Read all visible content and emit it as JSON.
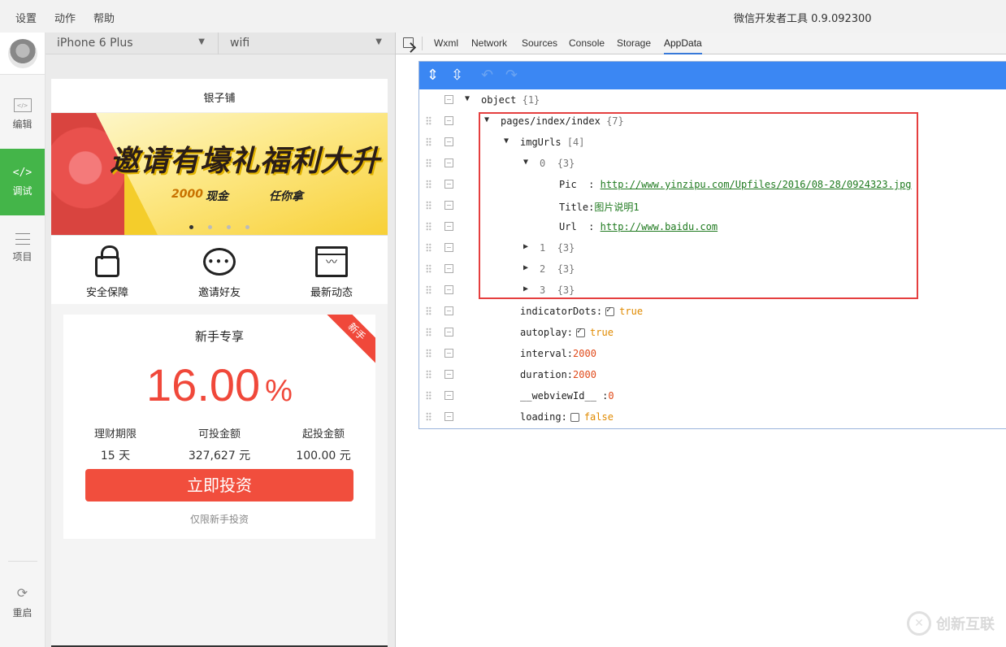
{
  "menu": {
    "items": [
      "设置",
      "动作",
      "帮助"
    ],
    "app_title": "微信开发者工具 0.9.092300"
  },
  "sidebar": {
    "items": [
      {
        "label": "编辑",
        "icon": "code-file-icon"
      },
      {
        "label": "调试",
        "icon": "code-brackets-icon",
        "glyph": "</>"
      },
      {
        "label": "项目",
        "icon": "list-icon"
      },
      {
        "label": "重启",
        "icon": "restart-icon"
      }
    ],
    "active": "调试"
  },
  "simulator": {
    "device": "iPhone 6 Plus",
    "network": "wifi"
  },
  "phone": {
    "nav_title": "银子铺",
    "banner": {
      "headline": "邀请有壕礼福利大升",
      "sub_cash": "2000",
      "sub_cash_unit": "现金",
      "sub_pick": "任你拿"
    },
    "features": [
      {
        "label": "安全保障",
        "icon": "lock-icon"
      },
      {
        "label": "邀请好友",
        "icon": "chat-bubble-icon"
      },
      {
        "label": "最新动态",
        "icon": "activity-monitor-icon"
      }
    ],
    "card": {
      "ribbon": "新手",
      "title": "新手专享",
      "rate_value": "16.00",
      "rate_unit": "%",
      "stats": [
        {
          "label": "理财期限",
          "value": "15 天"
        },
        {
          "label": "可投金额",
          "value": "327,627 元"
        },
        {
          "label": "起投金额",
          "value": "100.00 元"
        }
      ],
      "button": "立即投资",
      "note": "仅限新手投资"
    }
  },
  "devtools": {
    "tabs": [
      "Wxml",
      "Network",
      "Sources",
      "Console",
      "Storage",
      "AppData"
    ],
    "active_tab": "AppData",
    "tree": {
      "root": {
        "key": "object",
        "count": "{1}"
      },
      "page": {
        "key": "pages/index/index",
        "count": "{7}"
      },
      "imgUrls": {
        "key": "imgUrls",
        "count": "[4]"
      },
      "item0": {
        "key": "0",
        "count": "{3}"
      },
      "pic": {
        "key": "Pic",
        "value": "http://www.yinzipu.com/Upfiles/2016/08-28/0924323.jpg"
      },
      "title": {
        "key": "Title",
        "value": "图片说明1"
      },
      "url": {
        "key": "Url",
        "value": "http://www.baidu.com"
      },
      "item1": {
        "key": "1",
        "count": "{3}"
      },
      "item2": {
        "key": "2",
        "count": "{3}"
      },
      "item3": {
        "key": "3",
        "count": "{3}"
      },
      "indicatorDots": {
        "key": "indicatorDots",
        "value": "true"
      },
      "autoplay": {
        "key": "autoplay",
        "value": "true"
      },
      "interval": {
        "key": "interval",
        "value": "2000"
      },
      "duration": {
        "key": "duration",
        "value": "2000"
      },
      "webviewId": {
        "key": "__webviewId__",
        "value": "0"
      },
      "loading": {
        "key": "loading",
        "value": "false"
      }
    }
  },
  "watermark": {
    "text": "创新互联"
  },
  "colors": {
    "accent_green": "#44b549",
    "toolbar_blue": "#3b87f3",
    "highlight_red": "#e53f3f",
    "invest_red": "#f14e3d"
  }
}
